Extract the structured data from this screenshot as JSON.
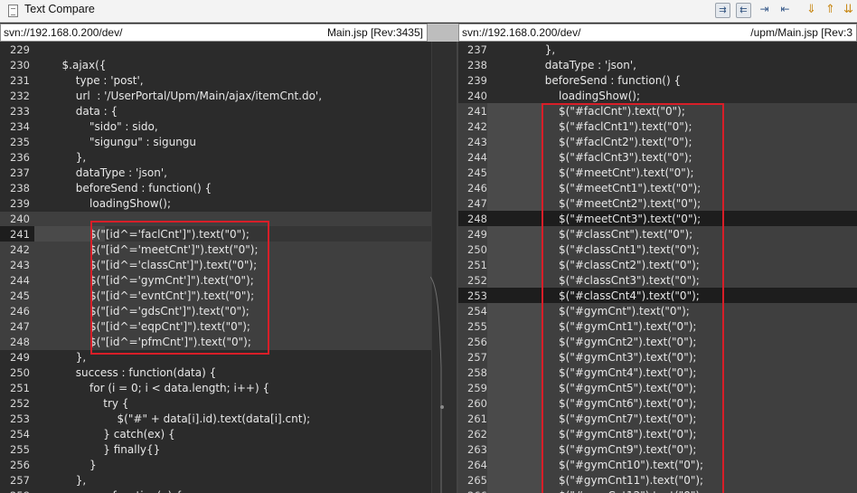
{
  "window": {
    "title": "Text Compare"
  },
  "toolbar": {
    "buttons": [
      {
        "name": "copy-all-left-to-right",
        "glyph": "⇉"
      },
      {
        "name": "copy-all-right-to-left",
        "glyph": "⇇"
      },
      {
        "name": "copy-current-left-to-right",
        "glyph": "⇥"
      },
      {
        "name": "copy-current-right-to-left",
        "glyph": "⇤"
      },
      {
        "name": "next-difference",
        "glyph": "⇓"
      },
      {
        "name": "previous-difference",
        "glyph": "⇑"
      },
      {
        "name": "more",
        "glyph": "⇊"
      }
    ]
  },
  "left": {
    "path": "svn://192.168.0.200/dev/",
    "file": "Main.jsp [Rev:3435]",
    "lines": [
      {
        "num": "229",
        "text": ""
      },
      {
        "num": "230",
        "text": "        $.ajax({"
      },
      {
        "num": "231",
        "text": "            type : 'post',"
      },
      {
        "num": "232",
        "text": "            url  : '/UserPortal/Upm/Main/ajax/itemCnt.do',"
      },
      {
        "num": "233",
        "text": "            data : {"
      },
      {
        "num": "234",
        "text": "                \"sido\" : sido,"
      },
      {
        "num": "235",
        "text": "                \"sigungu\" : sigungu"
      },
      {
        "num": "236",
        "text": "            },"
      },
      {
        "num": "237",
        "text": "            dataType : 'json',"
      },
      {
        "num": "238",
        "text": "            beforeSend : function() {"
      },
      {
        "num": "239",
        "text": "                loadingShow();"
      },
      {
        "num": "240",
        "text": ""
      },
      {
        "num": "241",
        "text": "                $(\"[id^='faclCnt']\").text(\"0\");"
      },
      {
        "num": "242",
        "text": "                $(\"[id^='meetCnt']\").text(\"0\");"
      },
      {
        "num": "243",
        "text": "                $(\"[id^='classCnt']\").text(\"0\");"
      },
      {
        "num": "244",
        "text": "                $(\"[id^='gymCnt']\").text(\"0\");"
      },
      {
        "num": "245",
        "text": "                $(\"[id^='evntCnt']\").text(\"0\");"
      },
      {
        "num": "246",
        "text": "                $(\"[id^='gdsCnt']\").text(\"0\");"
      },
      {
        "num": "247",
        "text": "                $(\"[id^='eqpCnt']\").text(\"0\");"
      },
      {
        "num": "248",
        "text": "                $(\"[id^='pfmCnt']\").text(\"0\");"
      },
      {
        "num": "249",
        "text": "            },"
      },
      {
        "num": "250",
        "text": "            success : function(data) {"
      },
      {
        "num": "251",
        "text": "                for (i = 0; i < data.length; i++) {"
      },
      {
        "num": "252",
        "text": "                    try {"
      },
      {
        "num": "253",
        "text": "                        $(\"#\" + data[i].id).text(data[i].cnt);"
      },
      {
        "num": "254",
        "text": "                    } catch(ex) {"
      },
      {
        "num": "255",
        "text": "                    } finally{}"
      },
      {
        "num": "256",
        "text": "                }"
      },
      {
        "num": "257",
        "text": "            },"
      },
      {
        "num": "258",
        "text": "            error : function(e) {"
      }
    ]
  },
  "right": {
    "path": "svn://192.168.0.200/dev/",
    "file": "/upm/Main.jsp [Rev:3",
    "lines": [
      {
        "num": "237",
        "text": "            },"
      },
      {
        "num": "238",
        "text": "            dataType : 'json',"
      },
      {
        "num": "239",
        "text": "            beforeSend : function() {"
      },
      {
        "num": "240",
        "text": "                loadingShow();"
      },
      {
        "num": "241",
        "text": "                $(\"#faclCnt\").text(\"0\");"
      },
      {
        "num": "242",
        "text": "                $(\"#faclCnt1\").text(\"0\");"
      },
      {
        "num": "243",
        "text": "                $(\"#faclCnt2\").text(\"0\");"
      },
      {
        "num": "244",
        "text": "                $(\"#faclCnt3\").text(\"0\");"
      },
      {
        "num": "245",
        "text": "                $(\"#meetCnt\").text(\"0\");"
      },
      {
        "num": "246",
        "text": "                $(\"#meetCnt1\").text(\"0\");"
      },
      {
        "num": "247",
        "text": "                $(\"#meetCnt2\").text(\"0\");"
      },
      {
        "num": "248",
        "text": "                $(\"#meetCnt3\").text(\"0\");"
      },
      {
        "num": "249",
        "text": "                $(\"#classCnt\").text(\"0\");"
      },
      {
        "num": "250",
        "text": "                $(\"#classCnt1\").text(\"0\");"
      },
      {
        "num": "251",
        "text": "                $(\"#classCnt2\").text(\"0\");"
      },
      {
        "num": "252",
        "text": "                $(\"#classCnt3\").text(\"0\");"
      },
      {
        "num": "253",
        "text": "                $(\"#classCnt4\").text(\"0\");"
      },
      {
        "num": "254",
        "text": "                $(\"#gymCnt\").text(\"0\");"
      },
      {
        "num": "255",
        "text": "                $(\"#gymCnt1\").text(\"0\");"
      },
      {
        "num": "256",
        "text": "                $(\"#gymCnt2\").text(\"0\");"
      },
      {
        "num": "257",
        "text": "                $(\"#gymCnt3\").text(\"0\");"
      },
      {
        "num": "258",
        "text": "                $(\"#gymCnt4\").text(\"0\");"
      },
      {
        "num": "259",
        "text": "                $(\"#gymCnt5\").text(\"0\");"
      },
      {
        "num": "260",
        "text": "                $(\"#gymCnt6\").text(\"0\");"
      },
      {
        "num": "261",
        "text": "                $(\"#gymCnt7\").text(\"0\");"
      },
      {
        "num": "262",
        "text": "                $(\"#gymCnt8\").text(\"0\");"
      },
      {
        "num": "263",
        "text": "                $(\"#gymCnt9\").text(\"0\");"
      },
      {
        "num": "264",
        "text": "                $(\"#gymCnt10\").text(\"0\");"
      },
      {
        "num": "265",
        "text": "                $(\"#gymCnt11\").text(\"0\");"
      },
      {
        "num": "266",
        "text": "                $(\"#gymCnt12\").text(\"0\");"
      }
    ]
  },
  "colors": {
    "editor_bg": "#2b2b2b",
    "changed_block_bg": "#3f3f3f",
    "current_line_bg": "#1d1d1d",
    "annotation_box": "#d81e28",
    "text": "#e8e8e8"
  }
}
